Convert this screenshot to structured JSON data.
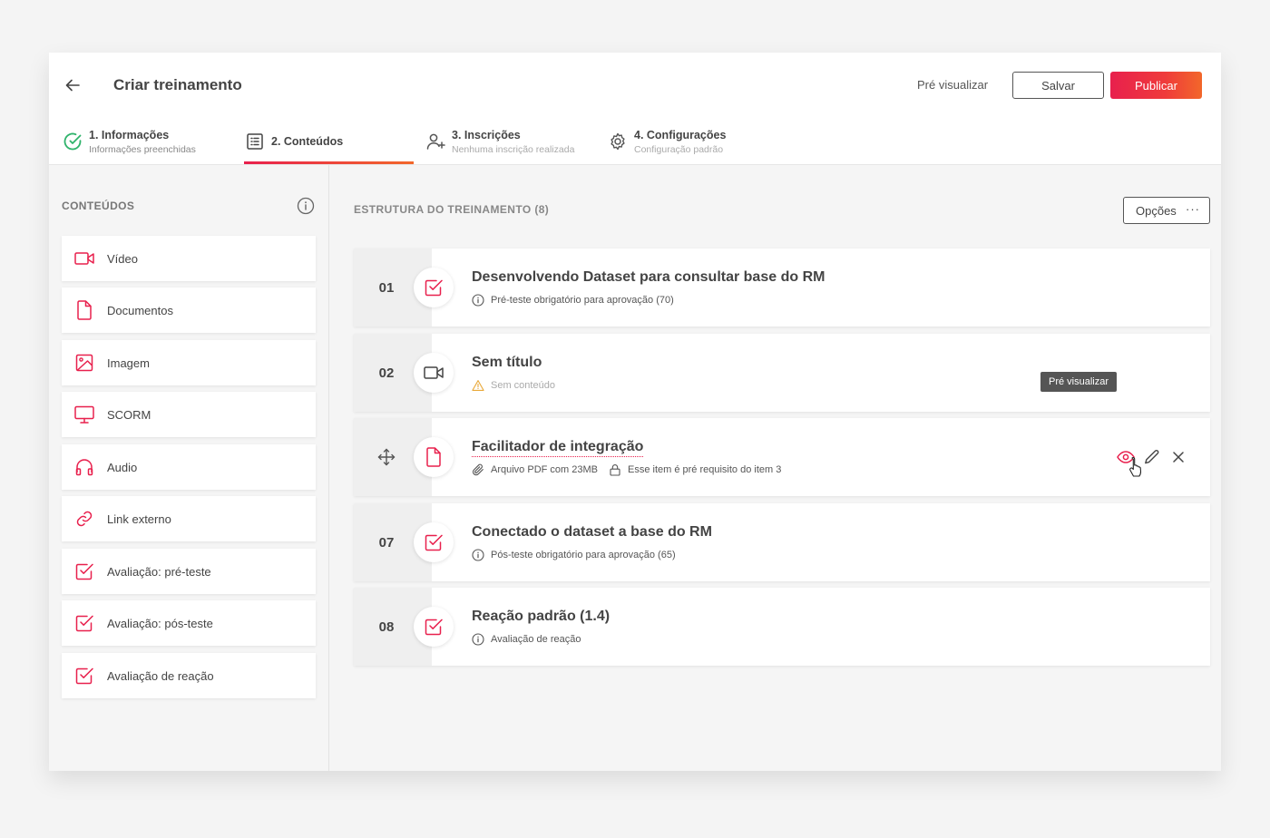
{
  "header": {
    "title": "Criar treinamento",
    "preview_label": "Pré visualizar",
    "save_label": "Salvar",
    "publish_label": "Publicar"
  },
  "steps": [
    {
      "title": "1. Informações",
      "subtitle": "Informações preenchidas",
      "icon": "check-circle-icon"
    },
    {
      "title": "2. Conteúdos",
      "subtitle": "",
      "icon": "list-icon"
    },
    {
      "title": "3. Inscrições",
      "subtitle": "Nenhuma inscrição realizada",
      "icon": "user-plus-icon"
    },
    {
      "title": "4. Configurações",
      "subtitle": "Configuração padrão",
      "icon": "gear-icon"
    }
  ],
  "sidebar": {
    "title": "CONTEÚDOS",
    "items": [
      {
        "label": "Vídeo",
        "icon": "video-icon"
      },
      {
        "label": "Documentos",
        "icon": "document-icon"
      },
      {
        "label": "Imagem",
        "icon": "image-icon"
      },
      {
        "label": "SCORM",
        "icon": "monitor-icon"
      },
      {
        "label": "Audio",
        "icon": "headphones-icon"
      },
      {
        "label": "Link externo",
        "icon": "link-icon"
      },
      {
        "label": "Avaliação: pré-teste",
        "icon": "checkbox-icon"
      },
      {
        "label": "Avaliação: pós-teste",
        "icon": "checkbox-icon"
      },
      {
        "label": "Avaliação de reação",
        "icon": "checkbox-icon"
      }
    ]
  },
  "main": {
    "title": "ESTRUTURA DO TREINAMENTO (8)",
    "options_label": "Opções",
    "items": [
      {
        "number": "01",
        "title": "Desenvolvendo Dataset para consultar base do RM",
        "meta": "Pré-teste obrigatório para aprovação (70)",
        "icon": "checkbox-icon"
      },
      {
        "number": "02",
        "title": "Sem título",
        "meta": "Sem conteúdo",
        "icon": "video-icon"
      },
      {
        "number": "",
        "title": "Facilitador de integração",
        "meta": "Arquivo PDF com 23MB",
        "meta2": "Esse item é pré requisito do item 3",
        "icon": "document-icon"
      },
      {
        "number": "07",
        "title": "Conectado o dataset a base do RM",
        "meta": "Pós-teste obrigatório para aprovação (65)",
        "icon": "checkbox-icon"
      },
      {
        "number": "08",
        "title": "Reação padrão (1.4)",
        "meta": "Avaliação de reação",
        "icon": "checkbox-icon"
      }
    ],
    "tooltip": "Pré visualizar"
  },
  "colors": {
    "accent": "#e8204d",
    "accent_end": "#f2672a",
    "success": "#2fb36b",
    "warning": "#e9a93a"
  }
}
